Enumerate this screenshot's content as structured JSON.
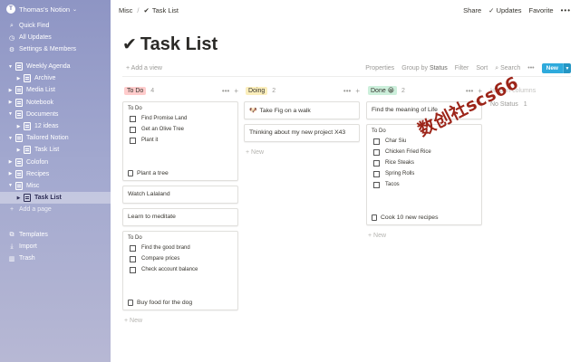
{
  "sidebar": {
    "workspace": "Thomas's Notion",
    "nav": [
      {
        "label": "Quick Find",
        "icon": "search-icon",
        "glyph": "🔍"
      },
      {
        "label": "All Updates",
        "icon": "clock-icon",
        "glyph": "◷"
      },
      {
        "label": "Settings & Members",
        "icon": "gear-icon",
        "glyph": "⚙"
      }
    ],
    "tree": [
      {
        "label": "Weekly Agenda",
        "depth": 0,
        "expanded": true,
        "active": false
      },
      {
        "label": "Archive",
        "depth": 1,
        "expanded": false,
        "active": false
      },
      {
        "label": "Media List",
        "depth": 0,
        "expanded": false,
        "active": false
      },
      {
        "label": "Notebook",
        "depth": 0,
        "expanded": false,
        "active": false
      },
      {
        "label": "Documents",
        "depth": 0,
        "expanded": true,
        "active": false
      },
      {
        "label": "12 ideas",
        "depth": 1,
        "expanded": false,
        "active": false
      },
      {
        "label": "Tailored Notion",
        "depth": 0,
        "expanded": true,
        "active": false
      },
      {
        "label": "Task List",
        "depth": 1,
        "expanded": false,
        "active": false
      },
      {
        "label": "Colofon",
        "depth": 0,
        "expanded": false,
        "active": false
      },
      {
        "label": "Recipes",
        "depth": 0,
        "expanded": false,
        "active": false
      },
      {
        "label": "Misc",
        "depth": 0,
        "expanded": true,
        "active": false
      },
      {
        "label": "Task List",
        "depth": 1,
        "expanded": false,
        "active": true
      }
    ],
    "add_page": "Add a page",
    "bottom": [
      {
        "label": "Templates",
        "icon": "templates-icon",
        "glyph": "⧉"
      },
      {
        "label": "Import",
        "icon": "import-icon",
        "glyph": "⤓"
      },
      {
        "label": "Trash",
        "icon": "trash-icon",
        "glyph": "🗑"
      }
    ]
  },
  "topbar": {
    "crumb_parent": "Misc",
    "crumb_current": "Task List",
    "share": "Share",
    "updates": "Updates",
    "favorite": "Favorite",
    "more": "•••"
  },
  "page": {
    "title": "Task List",
    "add_view": "+ Add a view",
    "properties": "Properties",
    "group_by": "Group by",
    "group_by_value": "Status",
    "filter": "Filter",
    "sort": "Sort",
    "search": "Search",
    "more": "•••",
    "new": "New"
  },
  "board": {
    "tools": "•••",
    "add": "+",
    "new_label": "+ New",
    "columns": [
      {
        "label": "To Do",
        "count": "4",
        "color": "#ffcccc",
        "cards": [
          {
            "type": "checklist",
            "heading": "To Do",
            "items": [
              "Find Promise Land",
              "Get an Olive Tree",
              "Plant it"
            ],
            "title": "Plant a tree"
          },
          {
            "type": "text",
            "title": "Watch Lalaland"
          },
          {
            "type": "text",
            "title": "Learn to meditate"
          },
          {
            "type": "checklist",
            "heading": "To Do",
            "items": [
              "Find the good brand",
              "Compare prices",
              "Check account balance"
            ],
            "title": "Buy food for the dog"
          }
        ]
      },
      {
        "label": "Doing",
        "count": "2",
        "color": "#fbeebb",
        "cards": [
          {
            "type": "text",
            "title": "Take Fig on a walk",
            "emoji": "🐶"
          },
          {
            "type": "text",
            "title": "Thinking about my new project X43"
          }
        ]
      },
      {
        "label": "Done",
        "emoji": "😀",
        "count": "2",
        "color": "#ccefdb",
        "cards": [
          {
            "type": "text",
            "title": "Find the meaning of Life"
          },
          {
            "type": "checklist",
            "heading": "To Do",
            "items": [
              "Char Siu",
              "Chicken Fried Rice",
              "Rice Steaks",
              "Spring Rolls",
              "Tacos"
            ],
            "title": "Cook 10 new recipes"
          }
        ]
      }
    ],
    "hidden": {
      "heading": "Hidden columns",
      "status": "No Status",
      "count": "1"
    }
  },
  "watermark": "数创社scs66"
}
